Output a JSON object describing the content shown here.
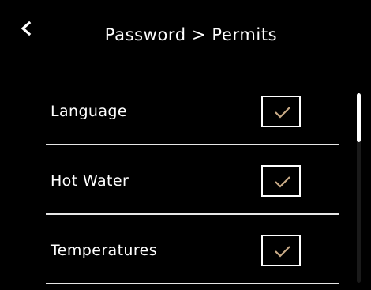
{
  "header": {
    "title": "Password > Permits",
    "back_icon": "chevron-left-icon"
  },
  "permits": [
    {
      "label": "Language",
      "checked": true
    },
    {
      "label": "Hot Water",
      "checked": true
    },
    {
      "label": "Temperatures",
      "checked": true
    }
  ],
  "colors": {
    "background": "#000000",
    "text": "#ffffff",
    "checkmark": "#c9ab87",
    "divider": "#e6e6e6"
  },
  "scroll": {
    "position_fraction": 0.0
  }
}
